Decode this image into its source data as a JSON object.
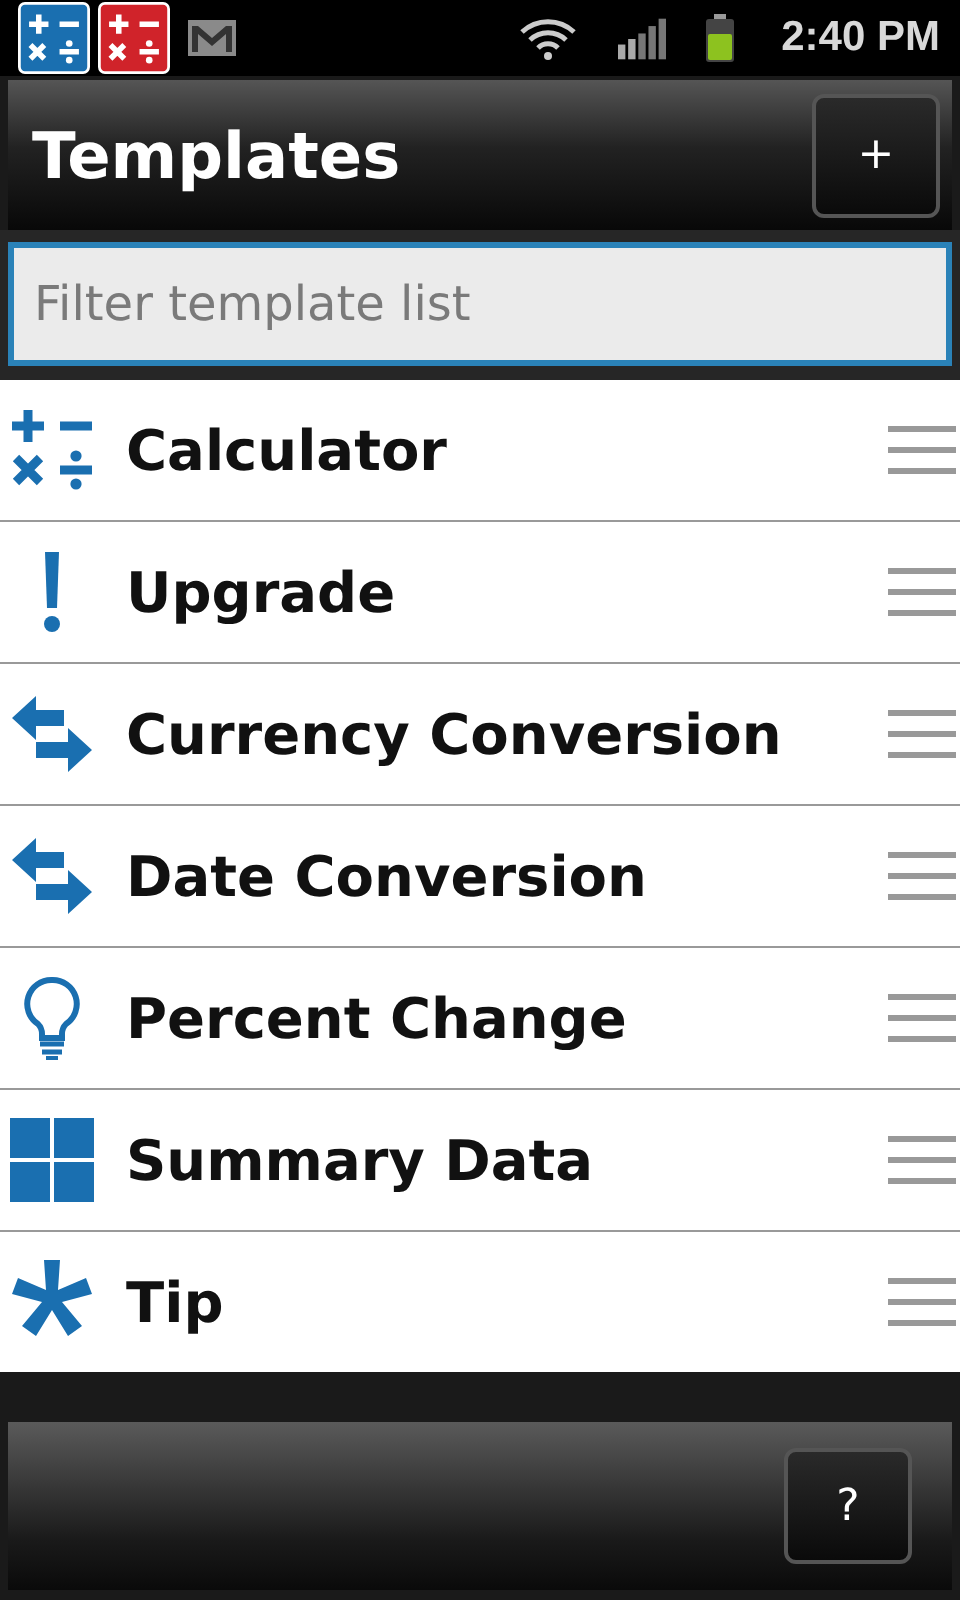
{
  "status_bar": {
    "notifications": [
      {
        "kind": "calculator",
        "color": "#1a6fb0"
      },
      {
        "kind": "calculator",
        "color": "#d0232a"
      },
      {
        "kind": "mail"
      }
    ],
    "time": "2:40 PM"
  },
  "header": {
    "title": "Templates",
    "add_button": "+"
  },
  "filter": {
    "placeholder": "Filter template list"
  },
  "templates": [
    {
      "kind": "calculator",
      "label": "Calculator"
    },
    {
      "kind": "exclamation",
      "label": "Upgrade"
    },
    {
      "kind": "swap",
      "label": "Currency Conversion"
    },
    {
      "kind": "swap",
      "label": "Date Conversion"
    },
    {
      "kind": "bulb",
      "label": "Percent Change"
    },
    {
      "kind": "grid",
      "label": "Summary Data"
    },
    {
      "kind": "asterisk",
      "label": "Tip"
    }
  ],
  "bottom_bar": {
    "help_button": "?"
  }
}
